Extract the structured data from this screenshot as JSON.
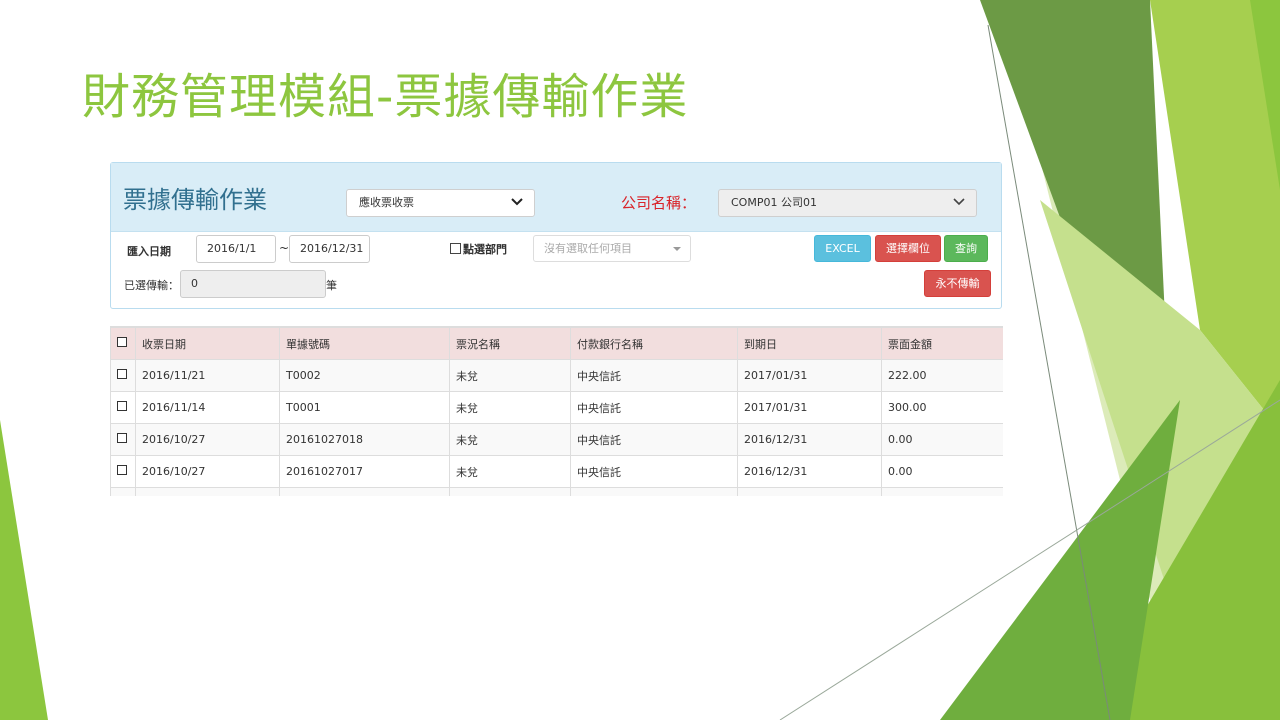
{
  "slide": {
    "title": "財務管理模組-票據傳輸作業"
  },
  "panel": {
    "title": "票據傳輸作業",
    "ticket_type": {
      "selected": "應收票收票"
    },
    "company_label": "公司名稱：",
    "company": {
      "selected": "COMP01 公司01"
    }
  },
  "filters": {
    "import_date_label": "匯入日期",
    "date_from": "2016/1/1",
    "date_sep": "~",
    "date_to": "2016/12/31",
    "dept_checkbox_label": "點選部門",
    "dept_placeholder": "沒有選取任何項目",
    "selected_transfer_label": "已選傳輸：",
    "selected_transfer_value": "0",
    "unit": "筆"
  },
  "buttons": {
    "excel": "EXCEL",
    "select_columns": "選擇欄位",
    "query": "查詢",
    "never_transfer": "永不傳輸"
  },
  "table": {
    "columns": [
      "收票日期",
      "單據號碼",
      "票況名稱",
      "付款銀行名稱",
      "到期日",
      "票面金額"
    ],
    "rows": [
      [
        "2016/11/21",
        "T0002",
        "未兌",
        "中央信託",
        "2017/01/31",
        "222.00"
      ],
      [
        "2016/11/14",
        "T0001",
        "未兌",
        "中央信託",
        "2017/01/31",
        "300.00"
      ],
      [
        "2016/10/27",
        "20161027018",
        "未兌",
        "中央信託",
        "2016/12/31",
        "0.00"
      ],
      [
        "2016/10/27",
        "20161027017",
        "未兌",
        "中央信託",
        "2016/12/31",
        "0.00"
      ]
    ]
  },
  "colors": {
    "title_green": "#8dc63f",
    "panel_heading": "#d9edf7",
    "panel_title": "#31708f",
    "company_label_red": "#d9242a",
    "table_header": "#f2dede"
  }
}
